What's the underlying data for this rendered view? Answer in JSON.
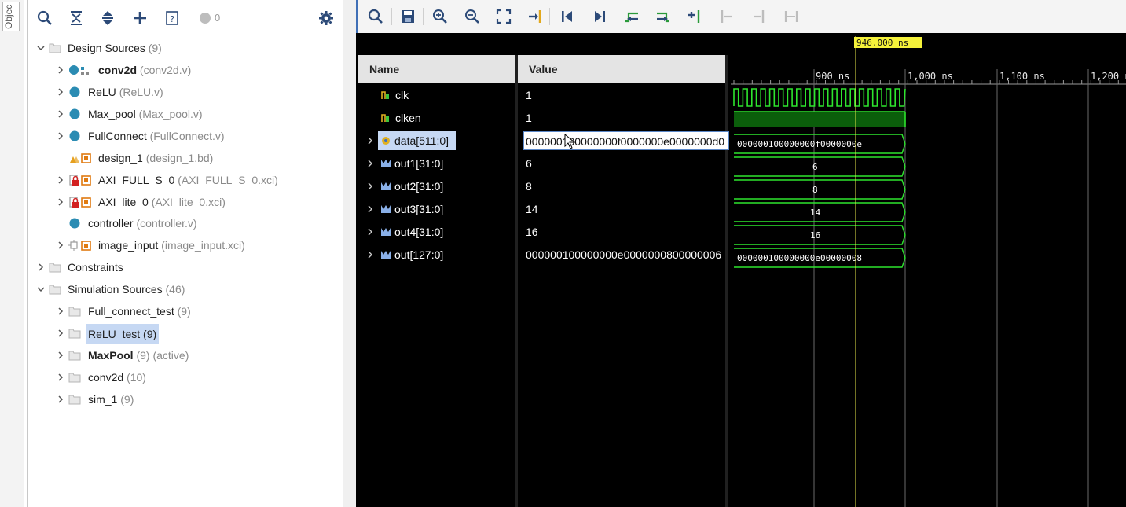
{
  "side_tab": {
    "label": "Objec"
  },
  "sources": {
    "toolbar": {
      "badge_count": "0"
    },
    "tree": [
      {
        "label": "Design Sources",
        "suffix": "(9)",
        "expanded": true
      },
      {
        "label": "conv2d",
        "suffix": "(conv2d.v)"
      },
      {
        "label": "ReLU",
        "suffix": "(ReLU.v)"
      },
      {
        "label": "Max_pool",
        "suffix": "(Max_pool.v)"
      },
      {
        "label": "FullConnect",
        "suffix": "(FullConnect.v)"
      },
      {
        "label": "design_1",
        "suffix": "(design_1.bd)"
      },
      {
        "label": "AXI_FULL_S_0",
        "suffix": "(AXI_FULL_S_0.xci)"
      },
      {
        "label": "AXI_lite_0",
        "suffix": "(AXI_lite_0.xci)"
      },
      {
        "label": "controller",
        "suffix": "(controller.v)"
      },
      {
        "label": "image_input",
        "suffix": "(image_input.xci)"
      },
      {
        "label": "Constraints",
        "suffix": ""
      },
      {
        "label": "Simulation Sources",
        "suffix": "(46)",
        "expanded": true
      },
      {
        "label": "Full_connect_test",
        "suffix": "(9)"
      },
      {
        "label": "ReLU_test",
        "suffix": "(9)",
        "selected": true
      },
      {
        "label": "MaxPool",
        "suffix": "(9) (active)"
      },
      {
        "label": "conv2d",
        "suffix": "(10)"
      },
      {
        "label": "sim_1",
        "suffix": "(9)"
      }
    ]
  },
  "wave": {
    "columns": {
      "name": "Name",
      "value": "Value"
    },
    "signals": [
      {
        "name": "clk",
        "value": "1"
      },
      {
        "name": "clken",
        "value": "1"
      },
      {
        "name": "data[511:0]",
        "value": "000000100000000f0000000e0000000d0",
        "selected": true
      },
      {
        "name": "out1[31:0]",
        "value": "6"
      },
      {
        "name": "out2[31:0]",
        "value": "8"
      },
      {
        "name": "out3[31:0]",
        "value": "14"
      },
      {
        "name": "out4[31:0]",
        "value": "16"
      },
      {
        "name": "out[127:0]",
        "value": "000000100000000e0000000800000006"
      }
    ],
    "cursor_label": "946.000 ns",
    "ruler_labels": [
      "900 ns",
      "1,000 ns",
      "1,100 ns",
      "1,200 ns"
    ],
    "bus_labels": [
      "000000100000000f0000000e",
      "6",
      "8",
      "14",
      "16",
      "000000100000000e00000008"
    ]
  },
  "colors": {
    "wave_green": "#2ee52e",
    "clken_fill": "#0b5e0b",
    "cursor_yellow": "#e6e64a",
    "selection_blue": "#c6d8f3",
    "toolbar_accent": "#3f6fb6"
  }
}
